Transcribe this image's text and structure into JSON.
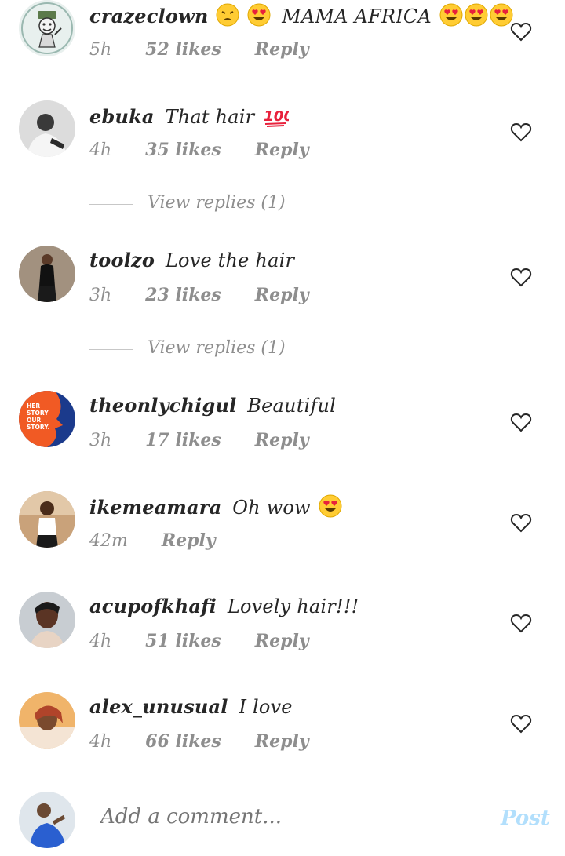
{
  "comments": [
    {
      "username": "crazeclown",
      "text": "MAMA AFRICA",
      "time": "5h",
      "likes": "52 likes",
      "reply": "Reply"
    },
    {
      "username": "ebuka",
      "text": "That hair",
      "time": "4h",
      "likes": "35 likes",
      "reply": "Reply"
    },
    {
      "username": "toolzo",
      "text": "Love the hair",
      "time": "3h",
      "likes": "23 likes",
      "reply": "Reply"
    },
    {
      "username": "theonlychigul",
      "text": "Beautiful",
      "time": "3h",
      "likes": "17 likes",
      "reply": "Reply",
      "avatar_text": "HER STORY OUR STORY"
    },
    {
      "username": "ikemeamara",
      "text": "Oh wow",
      "time": "42m",
      "reply": "Reply"
    },
    {
      "username": "acupofkhafi",
      "text": "Lovely hair!!!",
      "time": "4h",
      "likes": "51 likes",
      "reply": "Reply"
    },
    {
      "username": "alex_unusual",
      "text": "I love",
      "time": "4h",
      "likes": "66 likes",
      "reply": "Reply"
    }
  ],
  "view_replies": [
    "View replies (1)",
    "View replies (1)"
  ],
  "composer": {
    "placeholder": "Add a comment...",
    "post_label": "Post"
  },
  "colors": {
    "text": "#262626",
    "meta": "#8e8e8e",
    "post": "#b2dffc",
    "accent_orange": "#f15a24",
    "accent_blue": "#1b3a8c"
  },
  "icons": [
    "heart-outline-icon",
    "heart-eyes-emoji",
    "weary-face-emoji",
    "hundred-points-emoji"
  ]
}
